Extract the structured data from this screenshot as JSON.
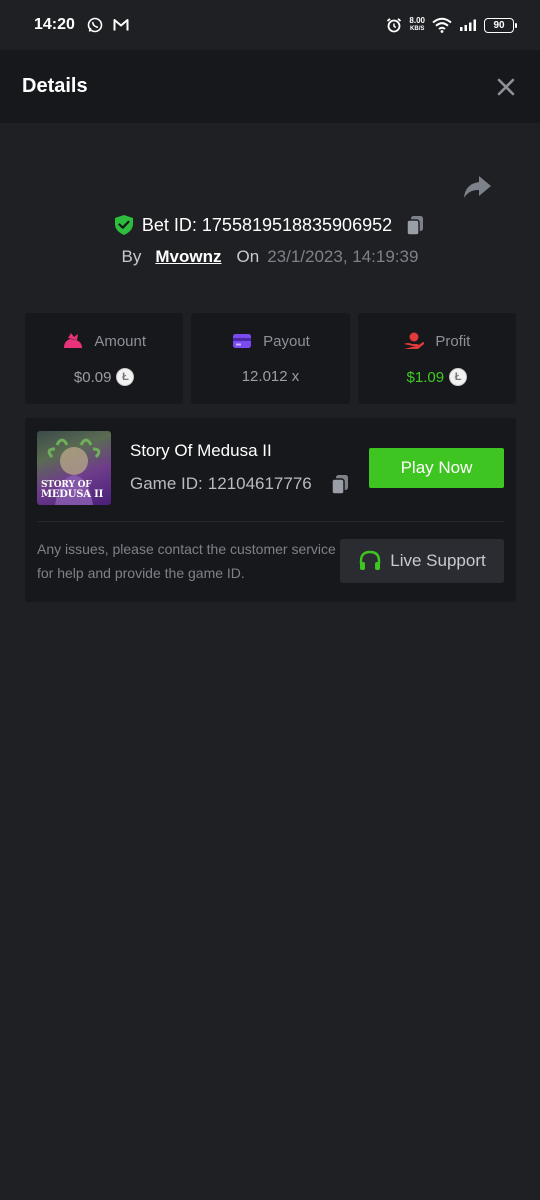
{
  "status_bar": {
    "time": "14:20",
    "net_speed_value": "8.00",
    "net_speed_unit": "KB/S",
    "battery": "90",
    "icons": [
      "whatsapp-icon",
      "gmail-icon",
      "alarm-icon",
      "wifi-icon",
      "signal-icon",
      "battery-icon"
    ]
  },
  "header": {
    "title": "Details",
    "close_icon": "close-icon"
  },
  "bet": {
    "label": "Bet ID:",
    "id": "1755819518835906952",
    "by_label": "By",
    "username": "Mvownz",
    "on_label": "On",
    "datetime": "23/1/2023, 14:19:39"
  },
  "stats": {
    "amount": {
      "label": "Amount",
      "value": "$0.09",
      "coin": "Ł"
    },
    "payout": {
      "label": "Payout",
      "value": "12.012 x"
    },
    "profit": {
      "label": "Profit",
      "value": "$1.09",
      "coin": "Ł"
    }
  },
  "game": {
    "name": "Story Of Medusa II",
    "id_label": "Game ID:",
    "id": "12104617776",
    "thumb_line1": "STORY OF",
    "thumb_line2": "MEDUSA II",
    "play_label": "Play Now",
    "support_text": "Any issues, please contact the customer service for help and provide the game ID.",
    "live_support_label": "Live Support"
  },
  "colors": {
    "accent_green": "#3fc521",
    "profit_green": "#3fcb21",
    "amount_pink": "#e8327a",
    "payout_purple": "#7b4bf0",
    "profit_red": "#e03a3a",
    "background": "#1f2024",
    "panel": "#17181b"
  }
}
